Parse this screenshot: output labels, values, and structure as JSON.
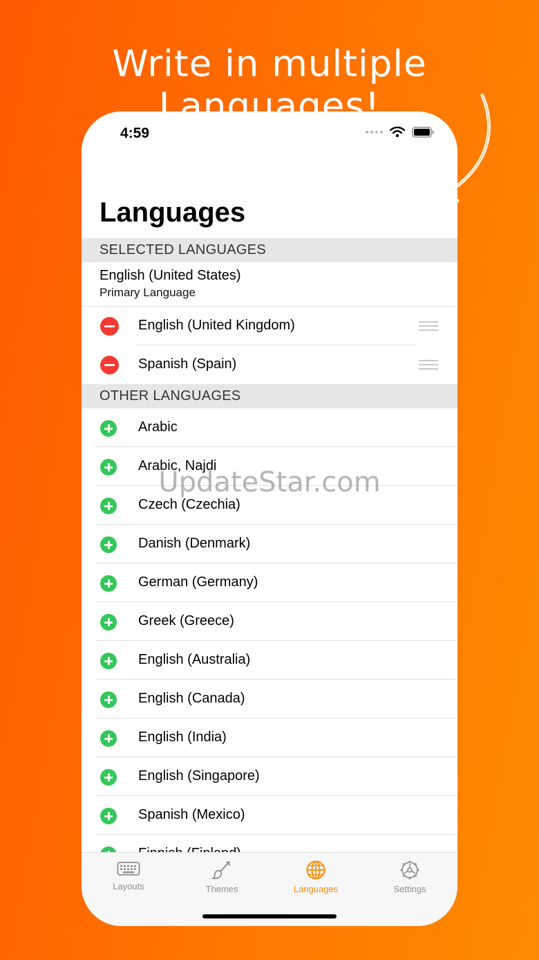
{
  "promo": {
    "headline": "Write in multiple Languages!"
  },
  "status_bar": {
    "time": "4:59"
  },
  "header": {
    "title": "Languages"
  },
  "selected_section": {
    "header": "SELECTED LANGUAGES",
    "primary": {
      "name": "English (United States)",
      "subtitle": "Primary Language"
    },
    "items": [
      {
        "label": "English (United Kingdom)"
      },
      {
        "label": "Spanish (Spain)"
      }
    ]
  },
  "other_section": {
    "header": "OTHER LANGUAGES",
    "items": [
      {
        "label": "Arabic"
      },
      {
        "label": "Arabic, Najdi"
      },
      {
        "label": "Czech (Czechia)"
      },
      {
        "label": "Danish (Denmark)"
      },
      {
        "label": "German (Germany)"
      },
      {
        "label": "Greek (Greece)"
      },
      {
        "label": "English (Australia)"
      },
      {
        "label": "English (Canada)"
      },
      {
        "label": "English (India)"
      },
      {
        "label": "English (Singapore)"
      },
      {
        "label": "Spanish (Mexico)"
      },
      {
        "label": "Finnish (Finland)"
      }
    ]
  },
  "tabbar": {
    "tabs": [
      {
        "label": "Layouts",
        "icon": "keyboard-icon"
      },
      {
        "label": "Themes",
        "icon": "paintbrush-icon"
      },
      {
        "label": "Languages",
        "icon": "globe-icon"
      },
      {
        "label": "Settings",
        "icon": "gear-icon"
      }
    ],
    "active_color": "#ff8a00",
    "inactive_color": "#8e8e93"
  },
  "watermark": "UpdateStar.com",
  "colors": {
    "remove": "#f23a33",
    "add": "#34c759",
    "background_start": "#ff5a00",
    "background_end": "#ff8a00"
  }
}
